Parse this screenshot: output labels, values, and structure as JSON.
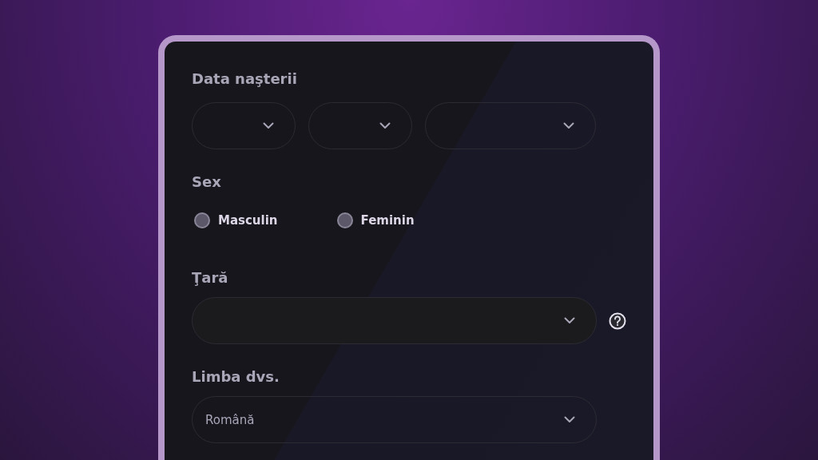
{
  "birth_date": {
    "label": "Data naşterii",
    "selects": [
      {
        "kind": "day"
      },
      {
        "kind": "month"
      },
      {
        "kind": "year"
      }
    ]
  },
  "sex": {
    "label": "Sex",
    "options": [
      {
        "label": "Masculin",
        "selected": false
      },
      {
        "label": "Feminin",
        "selected": false
      }
    ]
  },
  "country": {
    "label": "Ţară",
    "help": true
  },
  "language": {
    "label": "Limba dvs.",
    "value": "Română"
  }
}
